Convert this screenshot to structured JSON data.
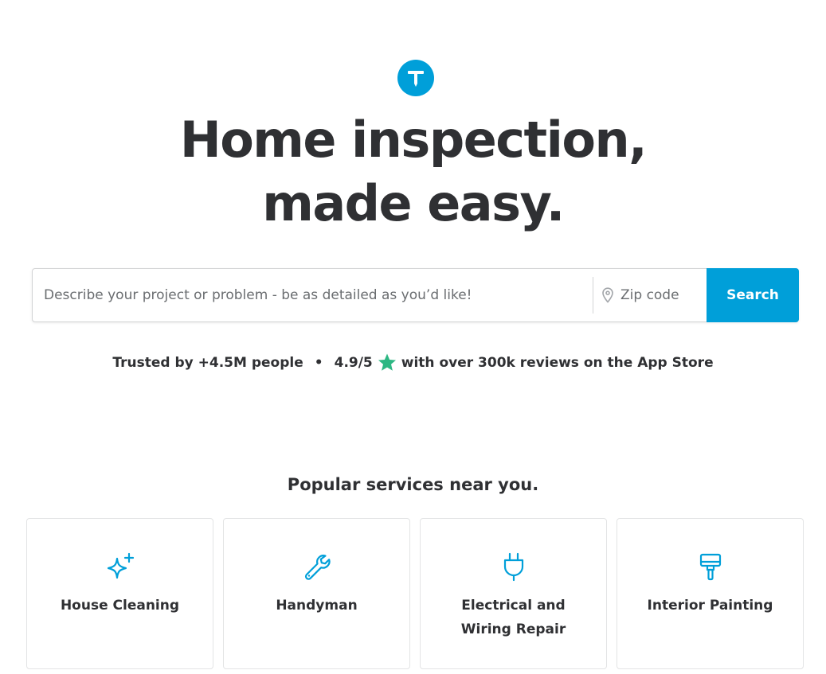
{
  "brand": {
    "logo_letter": "T",
    "accent": "#009fd9"
  },
  "hero": {
    "headline_line1": "Home inspection,",
    "headline_line2": "made easy."
  },
  "search": {
    "project_placeholder": "Describe your project or problem - be as detailed as you’d like!",
    "project_value": "",
    "zip_placeholder": "Zip code",
    "zip_value": "",
    "button_label": "Search"
  },
  "trust": {
    "people": "Trusted by +4.5M people",
    "separator": "•",
    "rating": "4.9/5",
    "rating_suffix": "with over 300k reviews on the App Store",
    "star_color": "#2db783"
  },
  "services": {
    "title": "Popular services near you.",
    "items": [
      {
        "label": "House Cleaning",
        "icon": "sparkle-icon"
      },
      {
        "label": "Handyman",
        "icon": "wrench-icon"
      },
      {
        "label": "Electrical and Wiring Repair",
        "icon": "plug-icon"
      },
      {
        "label": "Interior Painting",
        "icon": "paint-roller-icon"
      }
    ]
  }
}
